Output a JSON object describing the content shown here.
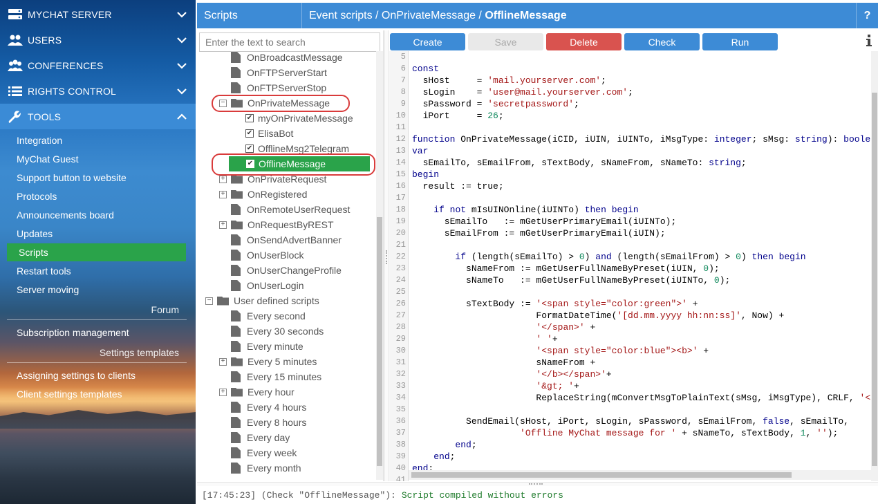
{
  "sidebar": {
    "sections": [
      {
        "label": "MYCHAT SERVER",
        "icon": "server-icon",
        "state": "collapsed"
      },
      {
        "label": "USERS",
        "icon": "users-icon",
        "state": "collapsed"
      },
      {
        "label": "CONFERENCES",
        "icon": "conferences-icon",
        "state": "collapsed"
      },
      {
        "label": "RIGHTS CONTROL",
        "icon": "list-icon",
        "state": "collapsed"
      },
      {
        "label": "TOOLS",
        "icon": "wrench-icon",
        "state": "expanded"
      }
    ],
    "tools_items": [
      "Integration",
      "MyChat Guest",
      "Support button to website",
      "Protocols",
      "Announcements board",
      "Updates",
      "Scripts",
      "Restart tools",
      "Server moving"
    ],
    "forum_label": "Forum",
    "subscription_label": "Subscription management",
    "settings_templates_label": "Settings templates",
    "assigning_label": "Assigning settings to clients",
    "client_templates_label": "Client settings templates"
  },
  "header": {
    "section": "Scripts",
    "breadcrumb_prefix": "Event scripts / OnPrivateMessage / ",
    "breadcrumb_current": "OfflineMessage",
    "help": "?"
  },
  "tree": {
    "search_placeholder": "Enter the text to search",
    "nodes": [
      {
        "label": "OnBroadcastMessage",
        "kind": "file",
        "level": 1
      },
      {
        "label": "OnFTPServerStart",
        "kind": "file",
        "level": 1
      },
      {
        "label": "OnFTPServerStop",
        "kind": "file",
        "level": 1
      },
      {
        "label": "OnPrivateMessage",
        "kind": "folder-open",
        "level": 1,
        "expander": "minus"
      },
      {
        "label": "myOnPrivateMessage",
        "kind": "check",
        "level": 2
      },
      {
        "label": "ElisaBot",
        "kind": "check",
        "level": 2
      },
      {
        "label": "OfflineMsg2Telegram",
        "kind": "check",
        "level": 2
      },
      {
        "label": "OfflineMessage",
        "kind": "check",
        "level": 2,
        "selected": true
      },
      {
        "label": "OnPrivateRequest",
        "kind": "folder",
        "level": 1,
        "expander": "plus"
      },
      {
        "label": "OnRegistered",
        "kind": "folder",
        "level": 1,
        "expander": "plus"
      },
      {
        "label": "OnRemoteUserRequest",
        "kind": "file",
        "level": 1
      },
      {
        "label": "OnRequestByREST",
        "kind": "folder",
        "level": 1,
        "expander": "plus"
      },
      {
        "label": "OnSendAdvertBanner",
        "kind": "file",
        "level": 1
      },
      {
        "label": "OnUserBlock",
        "kind": "file",
        "level": 1
      },
      {
        "label": "OnUserChangeProfile",
        "kind": "file",
        "level": 1
      },
      {
        "label": "OnUserLogin",
        "kind": "file",
        "level": 1
      },
      {
        "label": "User defined scripts",
        "kind": "folder-open",
        "level": 0,
        "expander": "minus"
      },
      {
        "label": "Every second",
        "kind": "file",
        "level": 1
      },
      {
        "label": "Every 30 seconds",
        "kind": "file",
        "level": 1
      },
      {
        "label": "Every minute",
        "kind": "file",
        "level": 1
      },
      {
        "label": "Every 5 minutes",
        "kind": "folder",
        "level": 1,
        "expander": "plus"
      },
      {
        "label": "Every 15 minutes",
        "kind": "file",
        "level": 1
      },
      {
        "label": "Every hour",
        "kind": "folder",
        "level": 1,
        "expander": "plus"
      },
      {
        "label": "Every 4 hours",
        "kind": "file",
        "level": 1
      },
      {
        "label": "Every 8 hours",
        "kind": "file",
        "level": 1
      },
      {
        "label": "Every day",
        "kind": "file",
        "level": 1
      },
      {
        "label": "Every week",
        "kind": "file",
        "level": 1
      },
      {
        "label": "Every month",
        "kind": "file",
        "level": 1
      }
    ]
  },
  "toolbar": {
    "create": "Create",
    "save": "Save",
    "delete": "Delete",
    "check": "Check",
    "run": "Run"
  },
  "editor": {
    "lines": [
      {
        "n": "5",
        "t": ""
      },
      {
        "n": "6",
        "t": "const"
      },
      {
        "n": "7",
        "t": "  sHost     = 'mail.yourserver.com';"
      },
      {
        "n": "8",
        "t": "  sLogin    = 'user@mail.yourserver.com';"
      },
      {
        "n": "9",
        "t": "  sPassword = 'secretpassword';"
      },
      {
        "n": "10",
        "t": "  iPort     = 26;"
      },
      {
        "n": "11",
        "t": ""
      },
      {
        "n": "12",
        "t": "function OnPrivateMessage(iCID, iUIN, iUINTo, iMsgType: integer; sMsg: string): boolean;"
      },
      {
        "n": "13",
        "t": "var"
      },
      {
        "n": "14",
        "t": "  sEmailTo, sEmailFrom, sTextBody, sNameFrom, sNameTo: string;"
      },
      {
        "n": "15",
        "t": "begin"
      },
      {
        "n": "16",
        "t": "  result := true;"
      },
      {
        "n": "17",
        "t": ""
      },
      {
        "n": "18",
        "t": "    if not mIsUINOnline(iUINTo) then begin"
      },
      {
        "n": "19",
        "t": "      sEmailTo   := mGetUserPrimaryEmail(iUINTo);"
      },
      {
        "n": "20",
        "t": "      sEmailFrom := mGetUserPrimaryEmail(iUIN);"
      },
      {
        "n": "21",
        "t": ""
      },
      {
        "n": "22",
        "t": "        if (length(sEmailTo) > 0) and (length(sEmailFrom) > 0) then begin"
      },
      {
        "n": "23",
        "t": "          sNameFrom := mGetUserFullNameByPreset(iUIN, 0);"
      },
      {
        "n": "24",
        "t": "          sNameTo   := mGetUserFullNameByPreset(iUINTo, 0);"
      },
      {
        "n": "25",
        "t": ""
      },
      {
        "n": "26",
        "t": "          sTextBody := '<span style=\"color:green\">' +"
      },
      {
        "n": "27",
        "t": "                       FormatDateTime('[dd.mm.yyyy hh:nn:ss]', Now) +"
      },
      {
        "n": "28",
        "t": "                       '</span>' +"
      },
      {
        "n": "29",
        "t": "                       ' '+"
      },
      {
        "n": "30",
        "t": "                       '<span style=\"color:blue\"><b>' +"
      },
      {
        "n": "31",
        "t": "                       sNameFrom +"
      },
      {
        "n": "32",
        "t": "                       '</b></span>'+"
      },
      {
        "n": "33",
        "t": "                       '&gt; '+"
      },
      {
        "n": "34",
        "t": "                       ReplaceString(mConvertMsgToPlainText(sMsg, iMsgType), CRLF, '</br>'"
      },
      {
        "n": "35",
        "t": ""
      },
      {
        "n": "36",
        "t": "          SendEmail(sHost, iPort, sLogin, sPassword, sEmailFrom, false, sEmailTo,"
      },
      {
        "n": "37",
        "t": "                    'Offline MyChat message for ' + sNameTo, sTextBody, 1, '');"
      },
      {
        "n": "38",
        "t": "        end;"
      },
      {
        "n": "39",
        "t": "    end;"
      },
      {
        "n": "40",
        "t": "end;"
      },
      {
        "n": "41",
        "t": ""
      }
    ]
  },
  "log": {
    "prefix": "[17:45:23] (Check \"OfflineMessage\"):",
    "message": "Script compiled without errors"
  },
  "colors": {
    "accent_blue": "#3d8bd6",
    "active_green": "#2aa34a",
    "delete_red": "#d9534f",
    "highlight_red": "#d93b3b",
    "keyword": "#00008b",
    "string": "#a31515"
  }
}
